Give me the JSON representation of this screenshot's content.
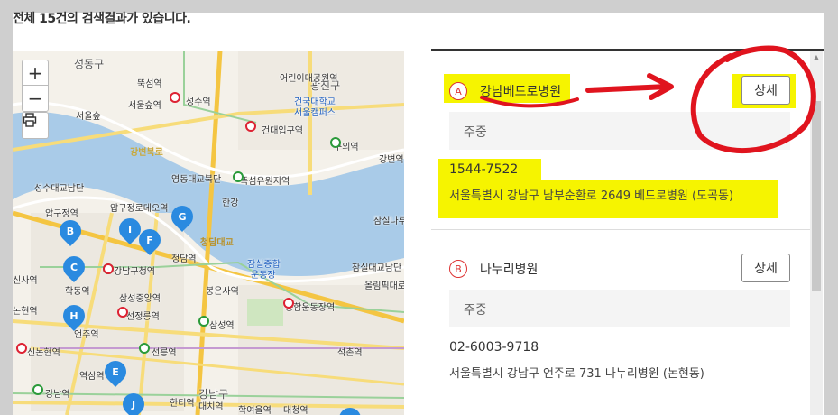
{
  "header": {
    "result_count": "전체 15건의 검색결과가 있습니다."
  },
  "map": {
    "zoom_in": "+",
    "zoom_out": "−",
    "labels": {
      "seongdong": "성동구",
      "gwangjin": "광진구",
      "ttukseom": "뚝섬역",
      "seoulsup": "서울숲역",
      "seongsu": "성수역",
      "seoulsup2": "서울숲",
      "konkuk": "건국대학교",
      "konkuk2": "서울캠퍼스",
      "kondae": "건대입구역",
      "children": "어린이대공원역",
      "guui": "구의역",
      "gangbyeon": "강변역",
      "gangbyeonbuk": "강변북로",
      "yeongdong": "영동대교북단",
      "ttukseomresort": "뚝섬유원지역",
      "seongsugyo": "성수대교남단",
      "apgujeong": "압구정역",
      "apgujeongrodeo": "압구정로데오역",
      "cheongdam": "청담역",
      "gangnamgu": "강남구청역",
      "jamsil": "잠실종합",
      "jamsil2": "운동장",
      "samseongjung": "삼성중앙역",
      "bongeunsa": "봉은사역",
      "sports": "종합운동장역",
      "hakdong": "학동역",
      "seonjeongneung": "선정릉역",
      "samseong": "삼성역",
      "nonhyeon": "논현역",
      "sinsa": "신사역",
      "eonju": "언주역",
      "seolleung": "선릉역",
      "sinnonhyeon": "신논현역",
      "yeoksam": "역삼역",
      "hanti": "한티역",
      "gangnam": "강남역",
      "daechi": "대치역",
      "hagyeoul": "학여울역",
      "daecheong": "대청역",
      "seokchon": "석촌역",
      "jamsilnaru": "잠실나루역",
      "jamsilbridge": "잠실대교남단",
      "olympic": "올림픽대로",
      "hangang": "한강",
      "cheongdambridge": "청담대교",
      "gangnamgu2": "강남구",
      "gwangjingu": "광진구"
    }
  },
  "results": [
    {
      "letter": "A",
      "name": "강남베드로병원",
      "detail": "상세",
      "parking": "주중",
      "phone": "1544-7522",
      "address": "서울특별시 강남구 남부순환로 2649 베드로병원 (도곡동)"
    },
    {
      "letter": "B",
      "name": "나누리병원",
      "detail": "상세",
      "parking": "주중",
      "phone": "02-6003-9718",
      "address": "서울특별시 강남구 언주로 731 나누리병원 (논현동)"
    }
  ],
  "colors": {
    "accent": "#d33333",
    "highlight": "#f6f400",
    "pin": "#2a8ae0",
    "annotation": "#e0141e"
  }
}
